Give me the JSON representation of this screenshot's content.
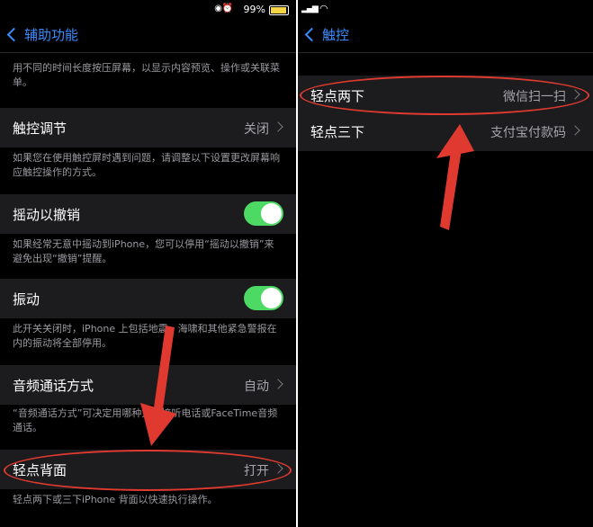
{
  "left": {
    "status": {
      "battery": "99%"
    },
    "nav": {
      "back_label": "辅助功能"
    },
    "intro_text": "用不同的时间长度按压屏幕，以显示内容预览、操作或关联菜单。",
    "touch_adjust": {
      "label": "触控调节",
      "value": "关闭",
      "footer": "如果您在使用触控屏时遇到问题，请调整以下设置更改屏幕响应触控操作的方式。"
    },
    "shake_undo": {
      "label": "摇动以撤销",
      "on": true,
      "footer": "如果经常无意中摇动到iPhone，您可以停用“摇动以撤销”来避免出现“撤销”提醒。"
    },
    "vibration": {
      "label": "振动",
      "on": true,
      "footer": "此开关关闭时，iPhone 上包括地震、海啸和其他紧急警报在内的振动将全部停用。"
    },
    "call_audio": {
      "label": "音频通话方式",
      "value": "自动",
      "footer": "“音频通话方式”可决定用哪种方式接听电话或FaceTime音频通话。"
    },
    "back_tap": {
      "label": "轻点背面",
      "value": "打开",
      "footer": "轻点两下或三下iPhone 背面以快速执行操作。"
    }
  },
  "right": {
    "nav": {
      "back_label": "触控"
    },
    "rows": [
      {
        "label": "轻点两下",
        "value": "微信扫一扫"
      },
      {
        "label": "轻点三下",
        "value": "支付宝付款码"
      }
    ]
  },
  "colors": {
    "accent": "#3a8cff",
    "toggle_on": "#4cd964",
    "annotation": "#e03a30"
  }
}
